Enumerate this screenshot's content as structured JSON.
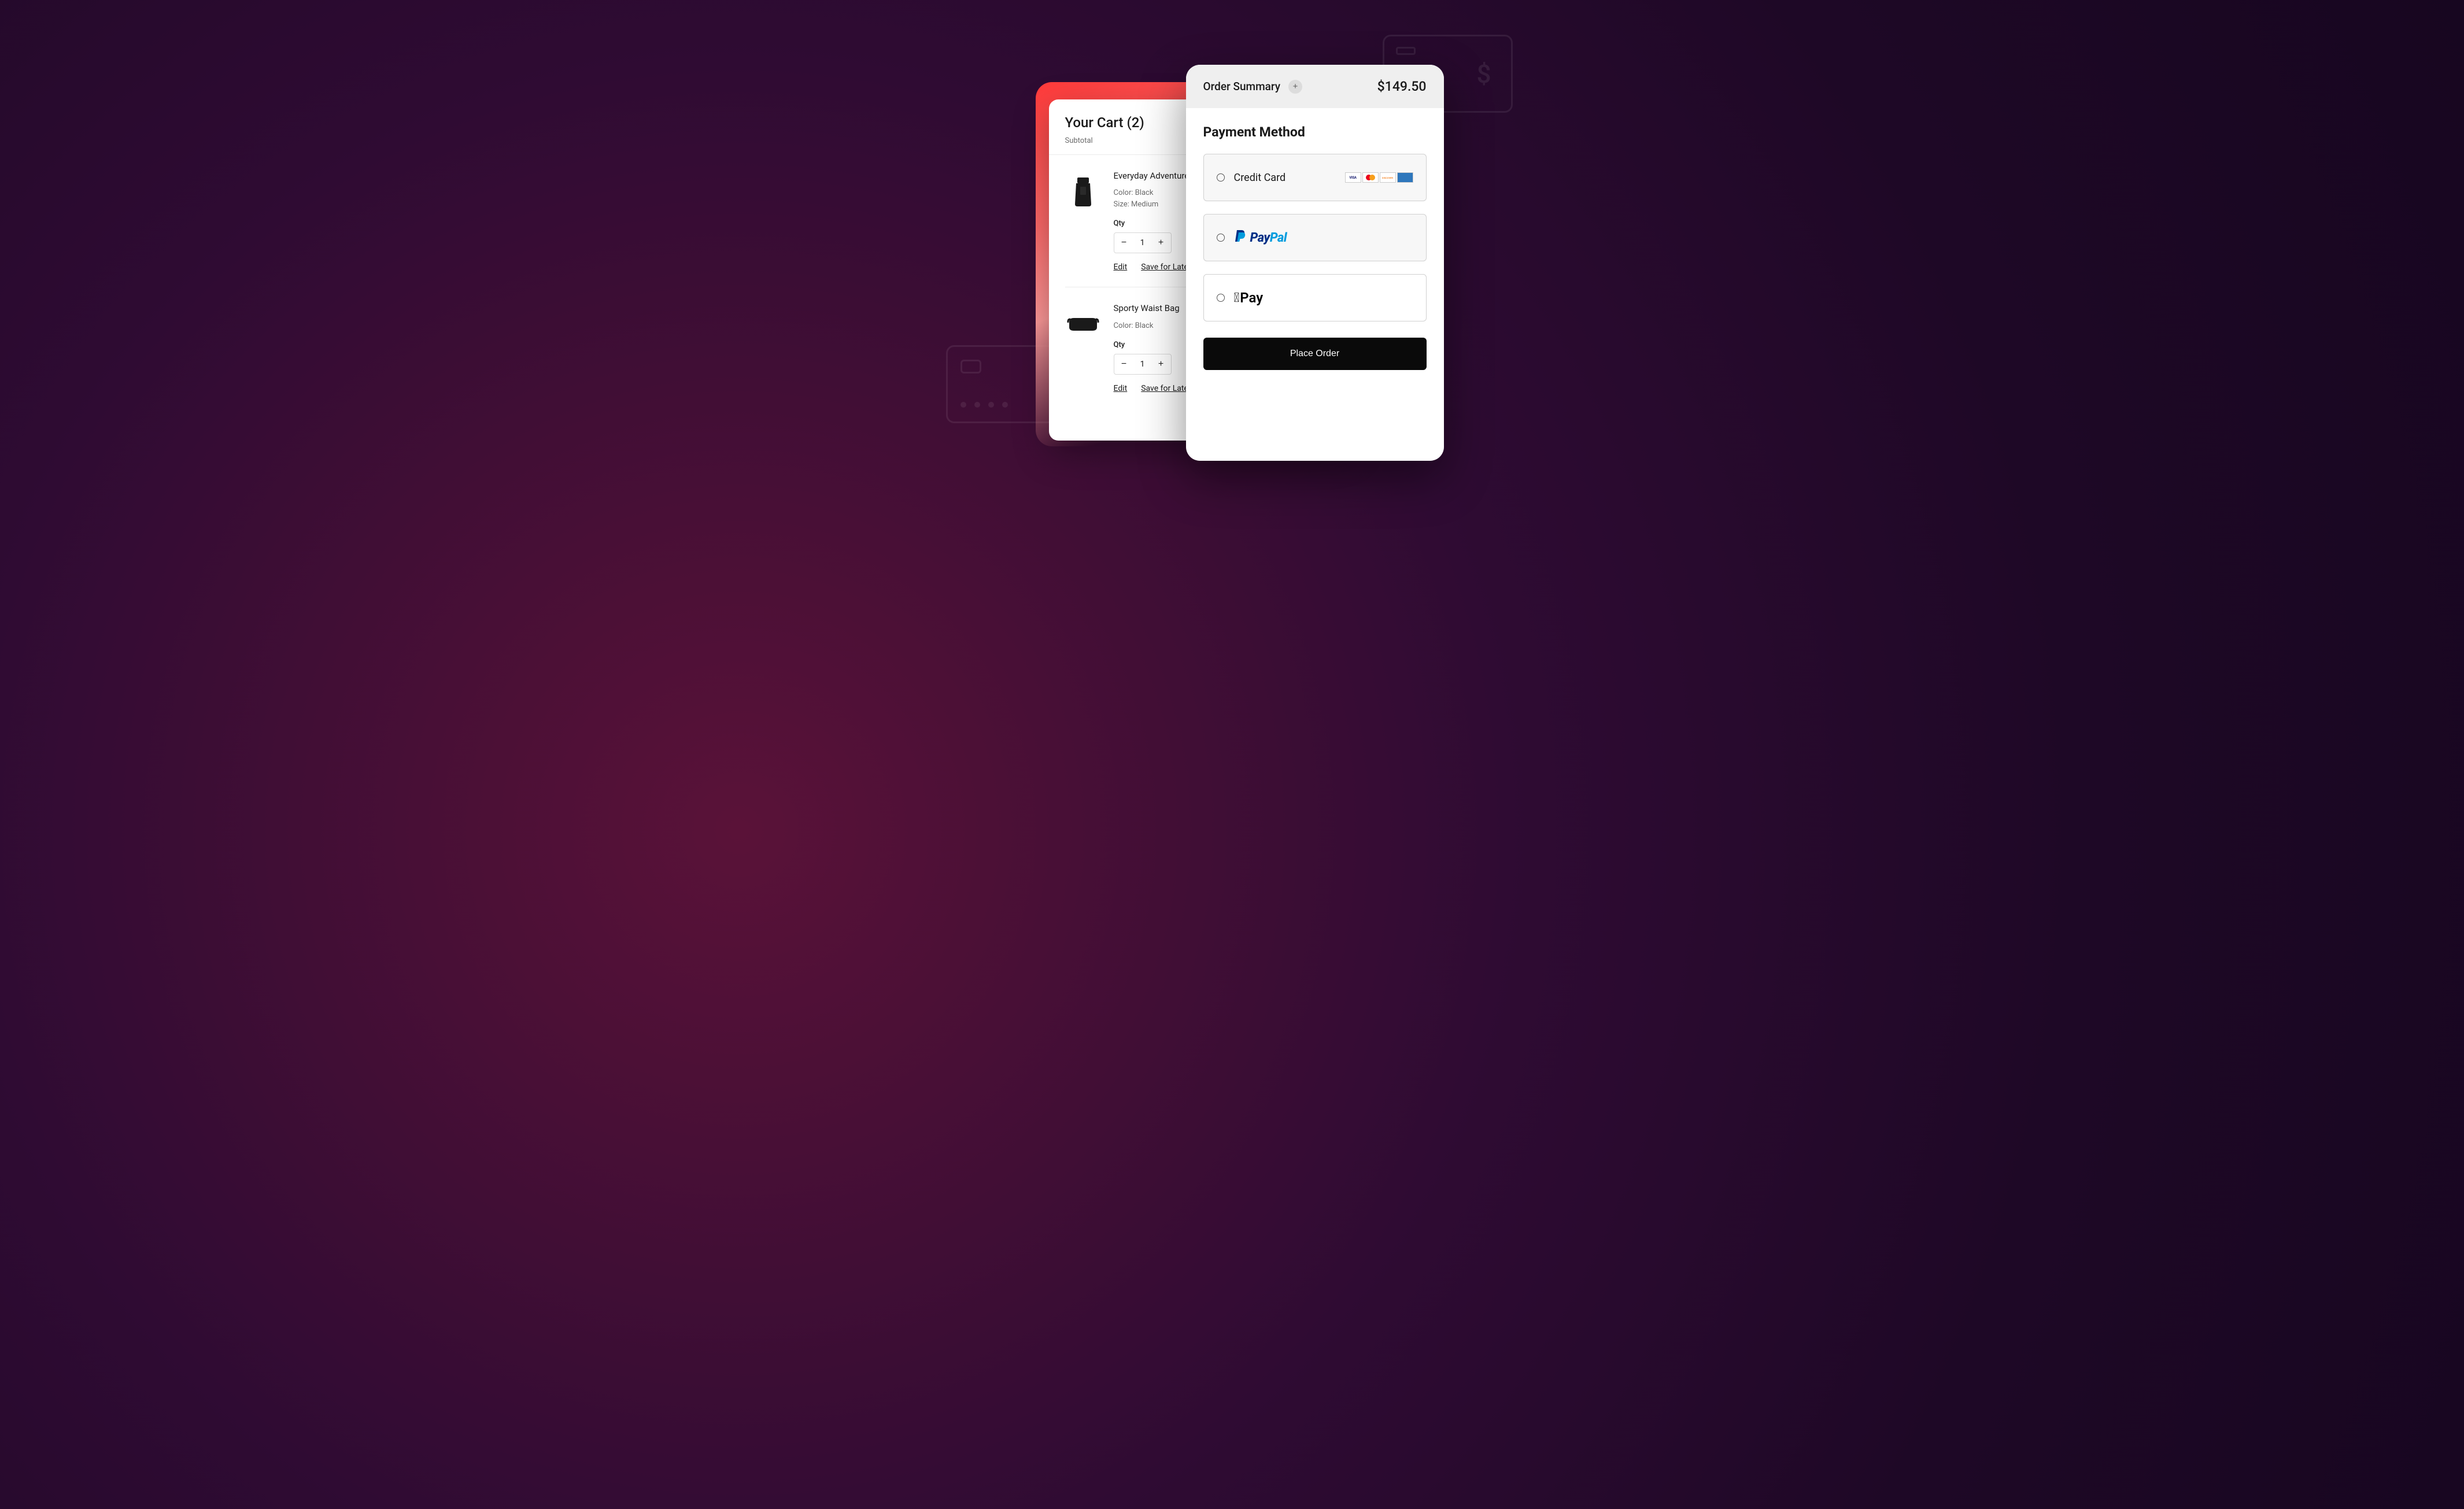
{
  "cart": {
    "title": "Your Cart (2)",
    "subtotal_label": "Subtotal",
    "qty_label": "Qty",
    "edit_label": "Edit",
    "save_later_label": "Save for Later",
    "items": [
      {
        "name": "Everyday Adventurer Medium Backpack",
        "color_line": "Color: Black",
        "size_line": "Size: Medium",
        "qty": "1"
      },
      {
        "name": "Sporty Waist Bag",
        "color_line": "Color: Black",
        "qty": "1"
      }
    ]
  },
  "checkout": {
    "summary_label": "Order Summary",
    "total": "$149.50",
    "payment_heading": "Payment Method",
    "options": {
      "credit_card": "Credit Card",
      "paypal_pay": "Pay",
      "paypal_pal": "Pal",
      "apple_pay": "Pay"
    },
    "place_order_label": "Place Order"
  }
}
